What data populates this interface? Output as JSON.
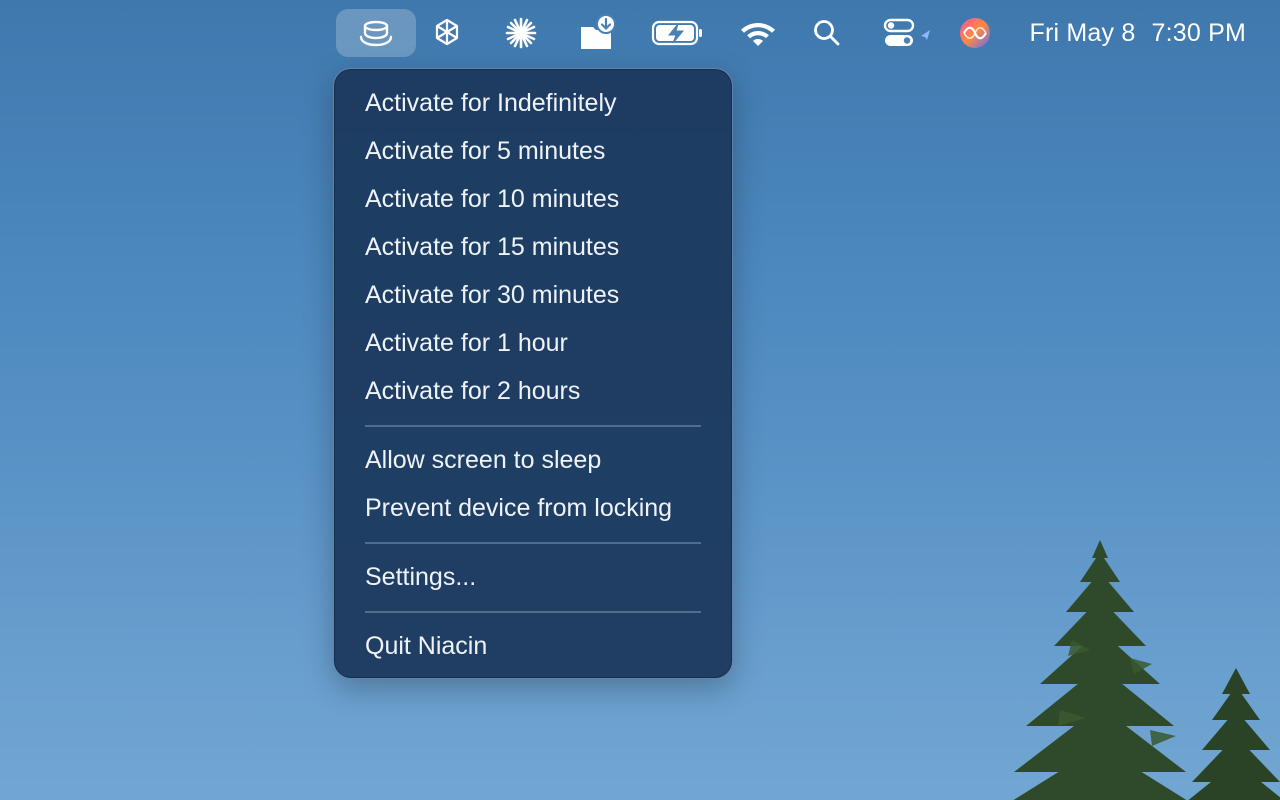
{
  "menubar": {
    "icons": [
      {
        "name": "coffee-cup-icon",
        "active": true
      },
      {
        "name": "openai-icon"
      },
      {
        "name": "asterisk-burst-icon"
      },
      {
        "name": "folder-download-icon"
      },
      {
        "name": "battery-charging-icon"
      },
      {
        "name": "wifi-icon"
      },
      {
        "name": "search-icon"
      },
      {
        "name": "control-center-icon"
      },
      {
        "name": "siri-icon"
      }
    ],
    "clock": {
      "date": "Fri May 8",
      "time": "7:30 PM"
    }
  },
  "menu": {
    "activate_items": [
      "Activate for Indefinitely",
      "Activate for 5 minutes",
      "Activate for 10 minutes",
      "Activate for 15 minutes",
      "Activate for 30 minutes",
      "Activate for 1 hour",
      "Activate for 2 hours"
    ],
    "option_items": [
      "Allow screen to sleep",
      "Prevent device from locking"
    ],
    "settings_label": "Settings...",
    "quit_label": "Quit Niacin"
  },
  "colors": {
    "menu_background": "#1c385c",
    "menu_text": "#eef3f8",
    "desktop_top": "#3f78ad",
    "desktop_bottom": "#72a6d2"
  }
}
